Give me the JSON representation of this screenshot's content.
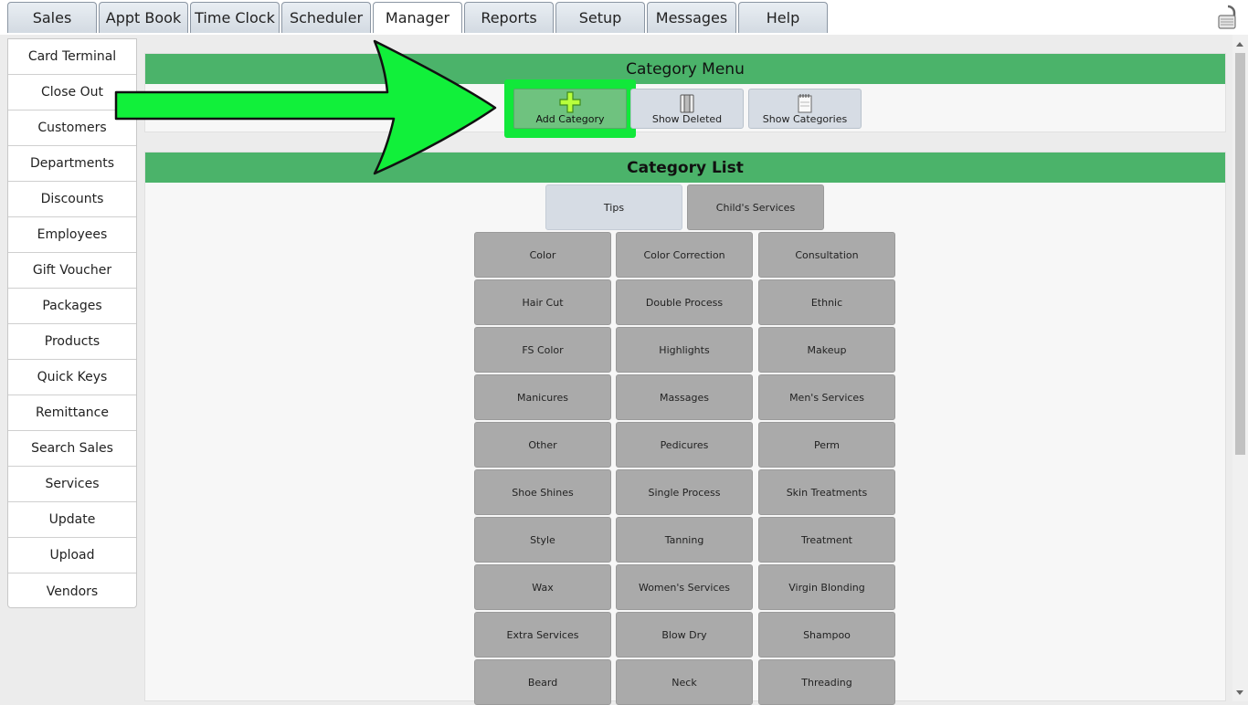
{
  "top_tabs": [
    "Sales",
    "Appt Book",
    "Time Clock",
    "Scheduler",
    "Manager",
    "Reports",
    "Setup",
    "Messages",
    "Help"
  ],
  "active_tab": "Manager",
  "left_menu": [
    "Card Terminal",
    "Close Out",
    "Customers",
    "Departments",
    "Discounts",
    "Employees",
    "Gift Voucher",
    "Packages",
    "Products",
    "Quick Keys",
    "Remittance",
    "Search Sales",
    "Services",
    "Update",
    "Upload",
    "Vendors"
  ],
  "category_menu": {
    "title": "Category Menu",
    "buttons": {
      "add": "Add Category",
      "deleted": "Show Deleted",
      "categories": "Show Categories"
    }
  },
  "category_list": {
    "title": "Category List",
    "top_row": [
      "Tips",
      "Child's Services"
    ],
    "grid": [
      [
        "Color",
        "Color Correction",
        "Consultation"
      ],
      [
        "Hair Cut",
        "Double Process",
        "Ethnic"
      ],
      [
        "FS Color",
        "Highlights",
        "Makeup"
      ],
      [
        "Manicures",
        "Massages",
        "Men's Services"
      ],
      [
        "Other",
        "Pedicures",
        "Perm"
      ],
      [
        "Shoe Shines",
        "Single Process",
        "Skin Treatments"
      ],
      [
        "Style",
        "Tanning",
        "Treatment"
      ],
      [
        "Wax",
        "Women's Services",
        "Virgin Blonding"
      ],
      [
        "Extra Services",
        "Blow Dry",
        "Shampoo"
      ],
      [
        "Beard",
        "Neck",
        "Threading"
      ]
    ]
  },
  "colors": {
    "header_green": "#4bb36a",
    "highlight_green": "#11e83a",
    "button_gray": "#aaaaaa"
  },
  "icons": {
    "lock": "lock-icon",
    "add": "plus-icon",
    "deleted": "trash-icon",
    "categories": "notepad-icon",
    "arrow": "arrow-pointer-icon"
  }
}
